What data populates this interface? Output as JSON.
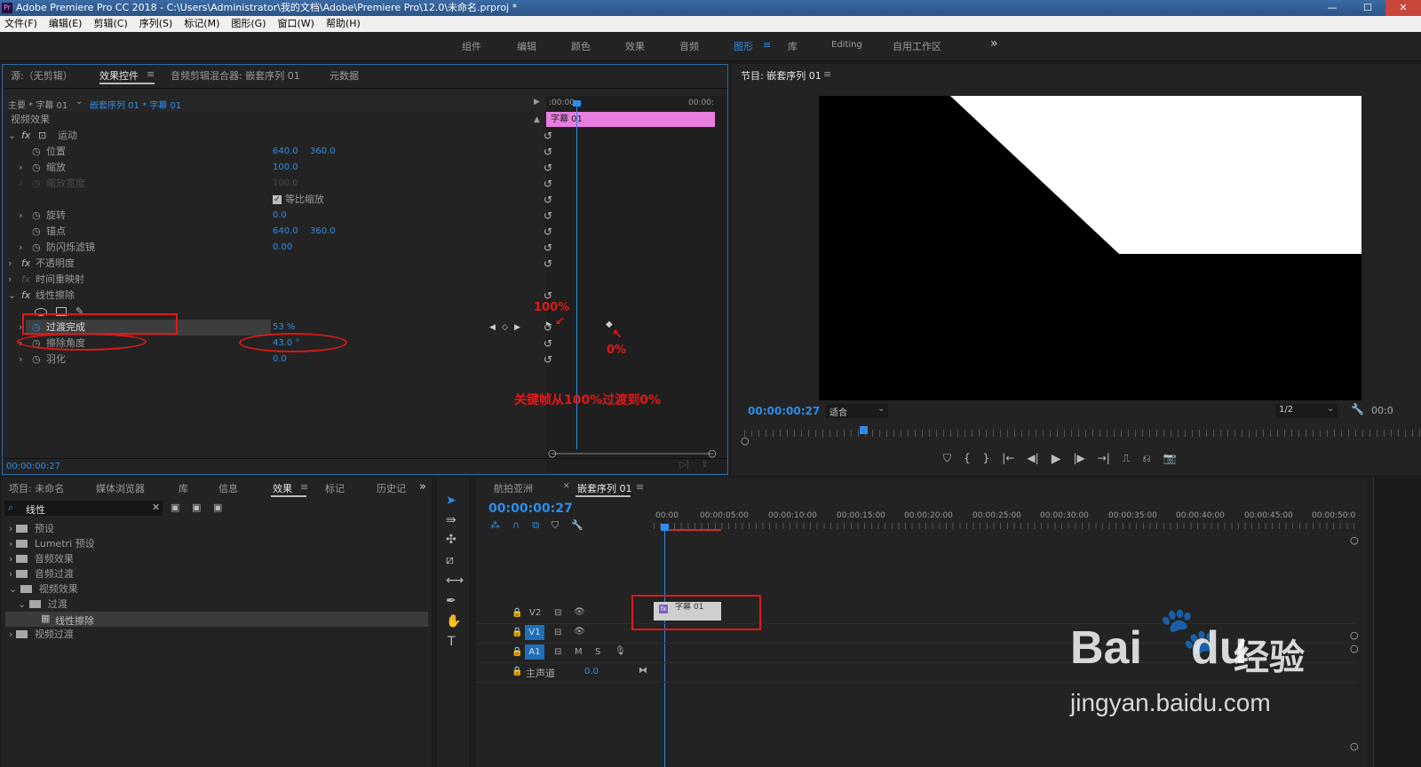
{
  "titlebar": {
    "title": "Adobe Premiere Pro CC 2018 - C:\\Users\\Administrator\\我的文档\\Adobe\\Premiere Pro\\12.0\\未命名.prproj *",
    "app_icon": "Pr",
    "minimize": "—",
    "maximize": "☐",
    "close": "✕"
  },
  "menu": [
    "文件(F)",
    "编辑(E)",
    "剪辑(C)",
    "序列(S)",
    "标记(M)",
    "图形(G)",
    "窗口(W)",
    "帮助(H)"
  ],
  "workspaces": {
    "items": [
      "组件",
      "编辑",
      "颜色",
      "效果",
      "音频",
      "图形",
      "库",
      "Editing",
      "自用工作区"
    ],
    "active": "图形",
    "more": "»"
  },
  "effect_controls": {
    "tabs": [
      "源:（无剪辑）",
      "效果控件",
      "音频剪辑混合器: 嵌套序列 01",
      "元数据"
    ],
    "master_label": "主要 * 字幕 01",
    "sequence_label": "嵌套序列 01 * 字幕 01",
    "timecode_start": ":00:00",
    "timecode_end": "00:00:",
    "clip_name": "字幕 01",
    "section_video": "视频效果",
    "motion": "运动",
    "position": {
      "label": "位置",
      "x": "640.0",
      "y": "360.0"
    },
    "scale": {
      "label": "缩放",
      "value": "100.0"
    },
    "scale_width": {
      "label": "缩放宽度",
      "value": "100.0"
    },
    "uniform_scale": "等比缩放",
    "rotation": {
      "label": "旋转",
      "value": "0.0"
    },
    "anchor": {
      "label": "锚点",
      "x": "640.0",
      "y": "360.0"
    },
    "antiflicker": {
      "label": "防闪烁滤镜",
      "value": "0.00"
    },
    "opacity": "不透明度",
    "time_remap": "时间重映射",
    "linear_wipe": "线性擦除",
    "transition_completion": {
      "label": "过渡完成",
      "value": "53 %"
    },
    "wipe_angle": {
      "label": "擦除角度",
      "value": "43.0 °"
    },
    "feather": {
      "label": "羽化",
      "value": "0.0"
    },
    "current_time": "00:00:00:27"
  },
  "annotations": {
    "hundred": "100%",
    "zero": "0%",
    "note": "关键帧从100%过渡到0%"
  },
  "program": {
    "title": "节目: 嵌套序列 01",
    "timecode": "00:00:00:27",
    "fit": "适合",
    "resolution": "1/2",
    "end_time": "00:0"
  },
  "project": {
    "tabs": [
      "项目: 未命名",
      "媒体浏览器",
      "库",
      "信息",
      "效果",
      "标记",
      "历史记"
    ],
    "active_tab": "效果",
    "search": "线性",
    "tree": [
      {
        "label": "预设",
        "level": 0,
        "open": false
      },
      {
        "label": "Lumetri 预设",
        "level": 0,
        "open": false
      },
      {
        "label": "音频效果",
        "level": 0,
        "open": false
      },
      {
        "label": "音频过渡",
        "level": 0,
        "open": false
      },
      {
        "label": "视频效果",
        "level": 0,
        "open": true
      },
      {
        "label": "过渡",
        "level": 1,
        "open": true
      },
      {
        "label": "线性擦除",
        "level": 2,
        "open": false
      },
      {
        "label": "视频过渡",
        "level": 0,
        "open": false
      }
    ]
  },
  "timeline": {
    "tabs": [
      "航拍亚洲",
      "嵌套序列 01"
    ],
    "timecode": "00:00:00:27",
    "ruler": [
      "00:00",
      "00:00:05:00",
      "00:00:10:00",
      "00:00:15:00",
      "00:00:20:00",
      "00:00:25:00",
      "00:00:30:00",
      "00:00:35:00",
      "00:00:40:00",
      "00:00:45:00",
      "00:00:50:0"
    ],
    "tracks": {
      "v2": "V2",
      "v1": "V1",
      "a1": "A1",
      "m": "M",
      "s": "S",
      "master": "主声道",
      "master_val": "0.0"
    },
    "clip": "字幕 01"
  },
  "watermark": {
    "brand": "Bai",
    "brand2": "du",
    "cn": "经验",
    "url": "jingyan.baidu.com"
  },
  "colors": {
    "accent": "#2d8ceb",
    "clip_pink": "#e87fe0",
    "annotation": "#e01818"
  }
}
